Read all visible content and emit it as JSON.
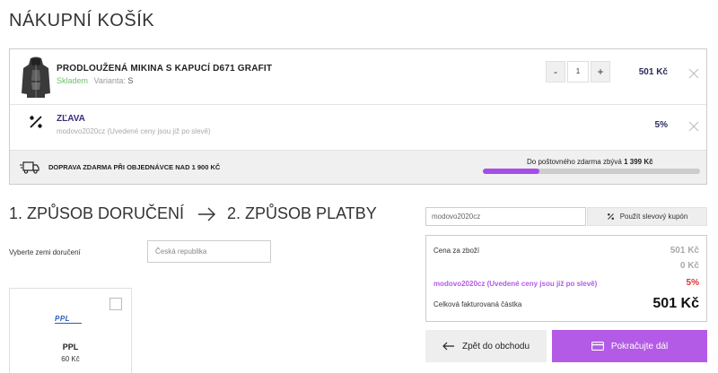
{
  "page": {
    "title": "NÁKUPNÍ KOŠÍK"
  },
  "cart": {
    "product": {
      "name": "PRODLOUŽENÁ MIKINA S KAPUCÍ D671 GRAFIT",
      "stock": "Skladem",
      "variant_label": "Varianta:",
      "variant_value": "S",
      "qty_minus": "-",
      "qty_value": "1",
      "qty_plus": "+",
      "price": "501 Kč",
      "image_icon": "hoodie-image"
    },
    "discount": {
      "name": "ZĽAVA",
      "note": "modovo2020cz (Uvedené ceny jsou již po slevě)",
      "value": "5%",
      "icon": "percent-icon"
    },
    "shipping": {
      "text": "DOPRAVA ZDARMA PŘI OBJEDNÁVCE NAD 1 900 KČ",
      "free_label": "Do poštovného zdarma zbývá",
      "free_amount": "1 399 Kč",
      "progress": 0.26,
      "icon": "truck-icon"
    }
  },
  "steps": {
    "step1": "1. ZPŮSOB DORUČENÍ",
    "step2": "2. ZPŮSOB PLATBY"
  },
  "delivery": {
    "country_label": "Vyberte zemi doručení",
    "country_placeholder": "Česká republika",
    "carrier": {
      "logo": "PPL",
      "name": "PPL",
      "price": "60 Kč"
    }
  },
  "coupon": {
    "value": "modovo2020cz",
    "button": "Použít slevový kupón"
  },
  "summary": {
    "goods_label": "Cena za zboží",
    "goods_value": "501 Kč",
    "shipping_value": "0 Kč",
    "discount_label": "modovo2020cz (Uvedené ceny jsou již po slevě)",
    "discount_value": "5%",
    "total_label": "Celková fakturovaná částka",
    "total_value": "501 Kč"
  },
  "buttons": {
    "back": "Zpět do obchodu",
    "next": "Pokračujte dál"
  },
  "colors": {
    "accent": "#b35be6",
    "discount_red": "#e0322f",
    "stock_green": "#6ec16e"
  }
}
